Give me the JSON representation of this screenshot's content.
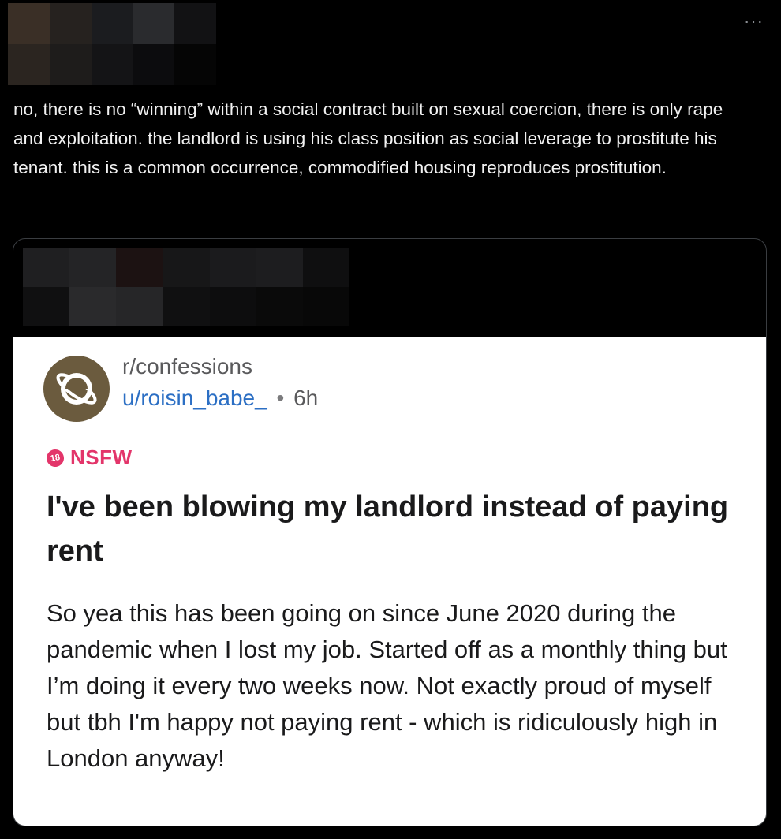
{
  "tweet": {
    "more_icon": "more-options-icon",
    "text": "no, there is no “winning” within a social contract built on sexual coercion, there is only rape and exploitation. the landlord is using his class position as social leverage to prostitute his tenant. this is a common occurrence, commodified housing reproduces prostitution."
  },
  "quoted_post": {
    "subreddit": "r/confessions",
    "username": "u/roisin_babe_",
    "separator": "•",
    "age": "6h",
    "nsfw_badge": "18",
    "nsfw_label": "NSFW",
    "title": "I've been blowing my landlord instead of paying rent",
    "body": "So yea this has been going on since June 2020 during the pandemic when I lost my job. Started off as a monthly thing but I’m doing it every two weeks now. Not exactly proud of myself but tbh I'm happy not paying rent - which is ridiculously high in London anyway!"
  },
  "colors": {
    "background": "#000000",
    "reddit_link": "#2c6fc4",
    "nsfw": "#e3356a",
    "subreddit_icon": "#6b5b3e"
  },
  "redaction_blocks": {
    "top": [
      "#3a2f26",
      "#26221f",
      "#1b1c1f",
      "#2a2b2e",
      "#121214",
      "#2b2520",
      "#1e1c1b",
      "#141416",
      "#0c0c0e",
      "#050505"
    ],
    "quote": [
      "#1f1f21",
      "#242426",
      "#1c1212",
      "#171718",
      "#1b1b1d",
      "#1d1d1f",
      "#0f0f10",
      "#101011",
      "#2a2a2c",
      "#262628",
      "#101011",
      "#0d0d0e",
      "#0a0a0a",
      "#080808"
    ]
  }
}
